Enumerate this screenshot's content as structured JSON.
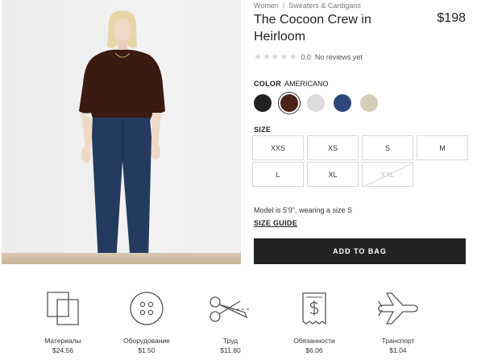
{
  "breadcrumb": {
    "level1": "Women",
    "separator": "/",
    "level2": "Sweaters & Cardigans"
  },
  "product": {
    "title": "The Cocoon Crew in Heirloom",
    "price": "$198"
  },
  "rating": {
    "stars_filled": 0,
    "stars_total": 5,
    "score": "0.0",
    "reviews_text": "No reviews yet"
  },
  "color": {
    "label": "COLOR",
    "selected_name": "AMERICANO",
    "swatches": [
      {
        "color": "#222222"
      },
      {
        "color": "#4a2218",
        "selected": true
      },
      {
        "color": "#dcdcdc"
      },
      {
        "color": "#2d4878"
      },
      {
        "color": "#d6cdb8"
      }
    ]
  },
  "size": {
    "label": "SIZE",
    "options": [
      {
        "label": "XXS",
        "available": true
      },
      {
        "label": "XS",
        "available": true
      },
      {
        "label": "S",
        "available": true
      },
      {
        "label": "M",
        "available": true
      },
      {
        "label": "L",
        "available": true
      },
      {
        "label": "XL",
        "available": true
      },
      {
        "label": "XXL",
        "available": false
      }
    ]
  },
  "model_info": "Model is 5'9\", wearing a size S",
  "size_guide": "SIZE GUIDE",
  "add_to_bag": "ADD TO BAG",
  "cost_breakdown": [
    {
      "icon": "fabric-icon",
      "label": "Материалы",
      "value": "$24.56"
    },
    {
      "icon": "button-icon",
      "label": "Оборудование",
      "value": "$1.50"
    },
    {
      "icon": "scissors-icon",
      "label": "Труд",
      "value": "$11.80"
    },
    {
      "icon": "receipt-dollar-icon",
      "label": "Обязанности",
      "value": "$6.06"
    },
    {
      "icon": "airplane-icon",
      "label": "Транспорт",
      "value": "$1.04"
    }
  ],
  "colors": {
    "button_bg": "#222222",
    "button_text": "#ffffff",
    "border": "#d8d8d8"
  }
}
